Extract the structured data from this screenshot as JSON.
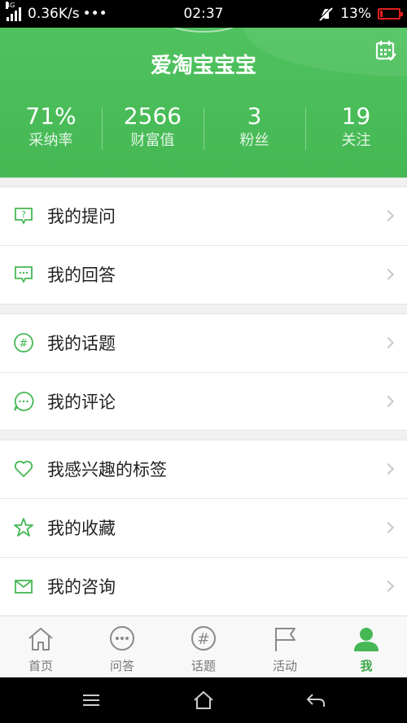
{
  "status_bar": {
    "network_type": "4G",
    "speed": "0.36K/s",
    "dots": "•••",
    "time": "02:37",
    "battery": "13%"
  },
  "header": {
    "username": "爱淘宝宝宝",
    "stats": [
      {
        "value": "71%",
        "label": "采纳率"
      },
      {
        "value": "2566",
        "label": "财富值"
      },
      {
        "value": "3",
        "label": "粉丝"
      },
      {
        "value": "19",
        "label": "关注"
      }
    ]
  },
  "menu": {
    "items": [
      {
        "label": "我的提问",
        "icon": "question-icon"
      },
      {
        "label": "我的回答",
        "icon": "answer-icon"
      },
      {
        "label": "我的话题",
        "icon": "hashtag-icon"
      },
      {
        "label": "我的评论",
        "icon": "comment-icon"
      },
      {
        "label": "我感兴趣的标签",
        "icon": "heart-icon"
      },
      {
        "label": "我的收藏",
        "icon": "star-icon"
      },
      {
        "label": "我的咨询",
        "icon": "mail-icon"
      }
    ]
  },
  "tabbar": {
    "tabs": [
      {
        "label": "首页",
        "icon": "home-icon"
      },
      {
        "label": "问答",
        "icon": "chat-icon"
      },
      {
        "label": "话题",
        "icon": "hashtag-icon"
      },
      {
        "label": "活动",
        "icon": "flag-icon"
      },
      {
        "label": "我",
        "icon": "person-icon"
      }
    ],
    "active": "我"
  },
  "colors": {
    "accent": "#45b854",
    "inactive": "#888888"
  }
}
